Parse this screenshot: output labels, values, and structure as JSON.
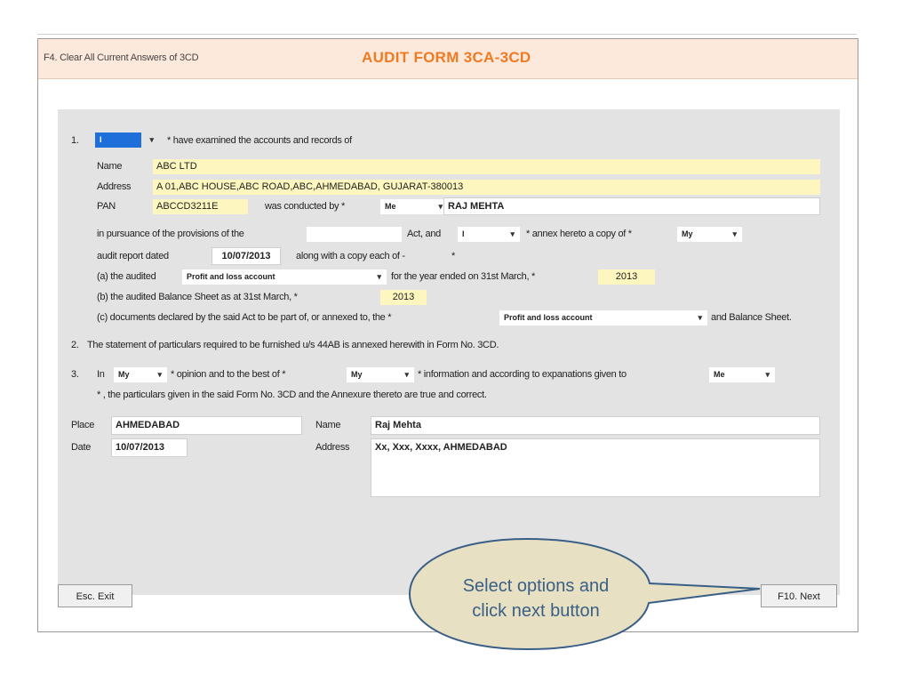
{
  "header": {
    "clear_label": "F4. Clear All Current Answers of 3CD",
    "title": "AUDIT FORM 3CA-3CD"
  },
  "s1": {
    "num": "1.",
    "who_select": "I",
    "examined_text": "* have examined the accounts and records of",
    "name_label": "Name",
    "name_value": "ABC LTD",
    "address_label": "Address",
    "address_value": "A 01,ABC HOUSE,ABC ROAD,ABC,AHMEDABAD, GUJARAT-380013",
    "pan_label": "PAN",
    "pan_value": "ABCCD3211E",
    "conducted_text": "was conducted by *",
    "conducted_select": "Me",
    "auditor_name": "RAJ MEHTA",
    "pursuance_text": "in pursuance of the provisions of the",
    "act_value": "",
    "act_and_text": "Act, and",
    "annex_select": "I",
    "annex_text": "* annex hereto a copy of *",
    "copy_select": "My",
    "report_dated_text": "audit report dated",
    "report_date": "10/07/2013",
    "copy_each_text": "along with a copy each of -",
    "star": "*",
    "a_text": "(a) the audited",
    "a_select": "Profit and loss account",
    "year_text": "for the year ended on 31st March, *",
    "year_value": "2013",
    "b_text": "(b) the audited Balance Sheet as at 31st March, *",
    "b_year": "2013",
    "c_text": "(c) documents declared by the said Act to be part of, or annexed to, the *",
    "c_select": "Profit and loss account",
    "c_end_text": "and Balance Sheet."
  },
  "s2": {
    "num": "2.",
    "text": "The statement of particulars required to be furnished u/s 44AB is annexed herewith in Form No. 3CD."
  },
  "s3": {
    "num": "3.",
    "in_text": "In",
    "opinion_select": "My",
    "opinion_text": "* opinion and to the best of *",
    "info_select": "My",
    "info_text": "* information and according to expanations given to",
    "given_select": "Me",
    "particulars_text": "* , the particulars given in the said Form No. 3CD and the Annexure thereto are true and correct."
  },
  "footer": {
    "place_label": "Place",
    "place_value": "AHMEDABAD",
    "date_label": "Date",
    "date_value": "10/07/2013",
    "name_label": "Name",
    "name_value": "Raj Mehta",
    "address_label": "Address",
    "address_value": "Xx, Xxx, Xxxx, AHMEDABAD"
  },
  "buttons": {
    "exit": "Esc. Exit",
    "next": "F10. Next"
  },
  "callout": {
    "line1": "Select options and",
    "line2": "click next button",
    "fill": "#e8e0c2",
    "stroke": "#3a5f86"
  }
}
